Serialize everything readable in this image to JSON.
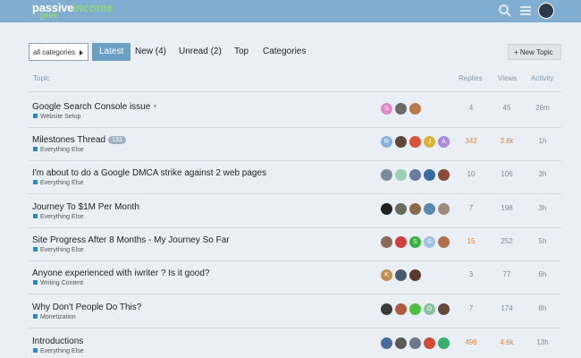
{
  "header": {
    "logo_main": "passive",
    "logo_accent": "income",
    "logo_sub": "geek"
  },
  "nav": {
    "category_dropdown": "all categories",
    "tabs": [
      "Latest",
      "New (4)",
      "Unread (2)",
      "Top",
      "Categories"
    ],
    "new_topic": "+ New Topic"
  },
  "table": {
    "headers": {
      "topic": "Topic",
      "replies": "Replies",
      "views": "Views",
      "activity": "Activity"
    },
    "rows": [
      {
        "title": "Google Search Console issue",
        "category": "Website Setup",
        "replies": "4",
        "views": "45",
        "activity": "26m",
        "pinned": true
      },
      {
        "title": "Milestones Thread",
        "badge": "132",
        "category": "Everything Else",
        "replies": "342",
        "views": "3.8k",
        "activity": "1h",
        "hot": true
      },
      {
        "title": "I'm about to do a Google DMCA strike against 2 web pages",
        "category": "Everything Else",
        "replies": "10",
        "views": "106",
        "activity": "3h"
      },
      {
        "title": "Journey To $1M Per Month",
        "category": "Everything Else",
        "replies": "7",
        "views": "198",
        "activity": "3h"
      },
      {
        "title": "Site Progress After 8 Months - My Journey So Far",
        "category": "Everything Else",
        "replies": "15",
        "views": "252",
        "activity": "5h",
        "hot_replies": true
      },
      {
        "title": "Anyone experienced with iwriter ? Is it good?",
        "category": "Writing Content",
        "replies": "3",
        "views": "77",
        "activity": "6h"
      },
      {
        "title": "Why Don't People Do This?",
        "category": "Monetization",
        "replies": "7",
        "views": "174",
        "activity": "8h"
      },
      {
        "title": "Introductions",
        "category": "Everything Else",
        "replies": "496",
        "views": "4.6k",
        "activity": "13h",
        "hot": true
      }
    ]
  },
  "avatars": [
    [
      "S",
      "",
      ""
    ],
    [
      "R",
      "",
      "",
      "J",
      "A"
    ],
    [
      "",
      "",
      "",
      "",
      ""
    ],
    [
      "",
      "",
      "",
      "",
      ""
    ],
    [
      "",
      "",
      "S",
      "S",
      ""
    ],
    [
      "K",
      "",
      ""
    ],
    [
      "",
      "",
      "",
      "D",
      ""
    ],
    [
      "",
      "",
      "",
      "",
      ""
    ]
  ],
  "avatar_colors": [
    [
      "#e08bc8",
      "#6a6a6a",
      "#b87a4a"
    ],
    [
      "#8ab4e0",
      "#5a4a3a",
      "#d6553a",
      "#d8b43a",
      "#a98ae0"
    ],
    [
      "#7a8a9a",
      "#9ad0b4",
      "#6a7aa0",
      "#3a6aa0",
      "#8a4a3a"
    ],
    [
      "#202020",
      "#6a6a5a",
      "#8a6a4a",
      "#5a8ab0",
      "#a08a7a"
    ],
    [
      "#8a6a5a",
      "#d04040",
      "#3ab040",
      "#a0c0e0",
      "#b07050"
    ],
    [
      "#c09050",
      "#4a5a6a",
      "#5a3a2a"
    ],
    [
      "#3a3a3a",
      "#b05a40",
      "#50c040",
      "#8ac0a0",
      "#6a4a3a"
    ],
    [
      "#4a6a9a",
      "#5a5a5a",
      "#6a7a8a",
      "#d04a3a",
      "#3ab070"
    ]
  ]
}
